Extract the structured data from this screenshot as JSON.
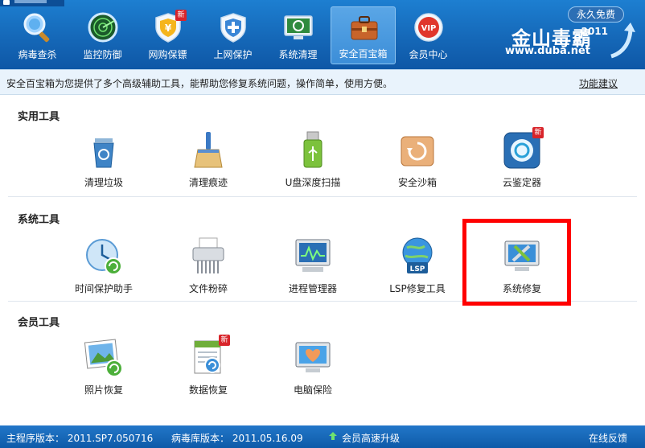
{
  "nav": {
    "items": [
      {
        "label": "病毒查杀",
        "icon": "magnifier-icon"
      },
      {
        "label": "监控防御",
        "icon": "radar-icon"
      },
      {
        "label": "网购保镖",
        "icon": "shopping-shield-icon",
        "badge": "新"
      },
      {
        "label": "上网保护",
        "icon": "shield-icon"
      },
      {
        "label": "系统清理",
        "icon": "recycle-monitor-icon"
      },
      {
        "label": "安全百宝箱",
        "icon": "toolbox-icon",
        "active": true
      },
      {
        "label": "会员中心",
        "icon": "vip-icon"
      }
    ]
  },
  "brand": {
    "free_label": "永久免费",
    "logo": "金山毒霸",
    "year": "2011",
    "url": "www.duba.net"
  },
  "infobar": {
    "description": "安全百宝箱为您提供了多个高级辅助工具，能帮助您修复系统问题，操作简单，使用方便。",
    "feedback": "功能建议"
  },
  "sections": {
    "practical": {
      "title": "实用工具",
      "tools": [
        {
          "label": "清理垃圾",
          "icon": "recycle-bin-icon"
        },
        {
          "label": "清理痕迹",
          "icon": "broom-icon"
        },
        {
          "label": "U盘深度扫描",
          "icon": "usb-drive-icon"
        },
        {
          "label": "安全沙箱",
          "icon": "sandbox-icon"
        },
        {
          "label": "云鉴定器",
          "icon": "cloud-identify-icon",
          "badge": "新"
        }
      ]
    },
    "system": {
      "title": "系统工具",
      "tools": [
        {
          "label": "时间保护助手",
          "icon": "clock-icon"
        },
        {
          "label": "文件粉碎",
          "icon": "shredder-icon"
        },
        {
          "label": "进程管理器",
          "icon": "process-monitor-icon"
        },
        {
          "label": "LSP修复工具",
          "icon": "lsp-globe-icon"
        },
        {
          "label": "系统修复",
          "icon": "system-repair-icon"
        }
      ]
    },
    "member": {
      "title": "会员工具",
      "tools": [
        {
          "label": "照片恢复",
          "icon": "photo-restore-icon"
        },
        {
          "label": "数据恢复",
          "icon": "data-restore-icon",
          "badge": "新"
        },
        {
          "label": "电脑保险",
          "icon": "pc-insurance-icon"
        }
      ]
    }
  },
  "statusbar": {
    "program_version": "主程序版本： 2011.SP7.050716",
    "virus_db_version": "病毒库版本： 2011.05.16.09",
    "upgrade": "会员高速升级",
    "online_feedback": "在线反馈"
  },
  "colors": {
    "header_blue": "#1568b8",
    "highlight_red": "#ff0000",
    "badge_red": "#d8242a"
  }
}
